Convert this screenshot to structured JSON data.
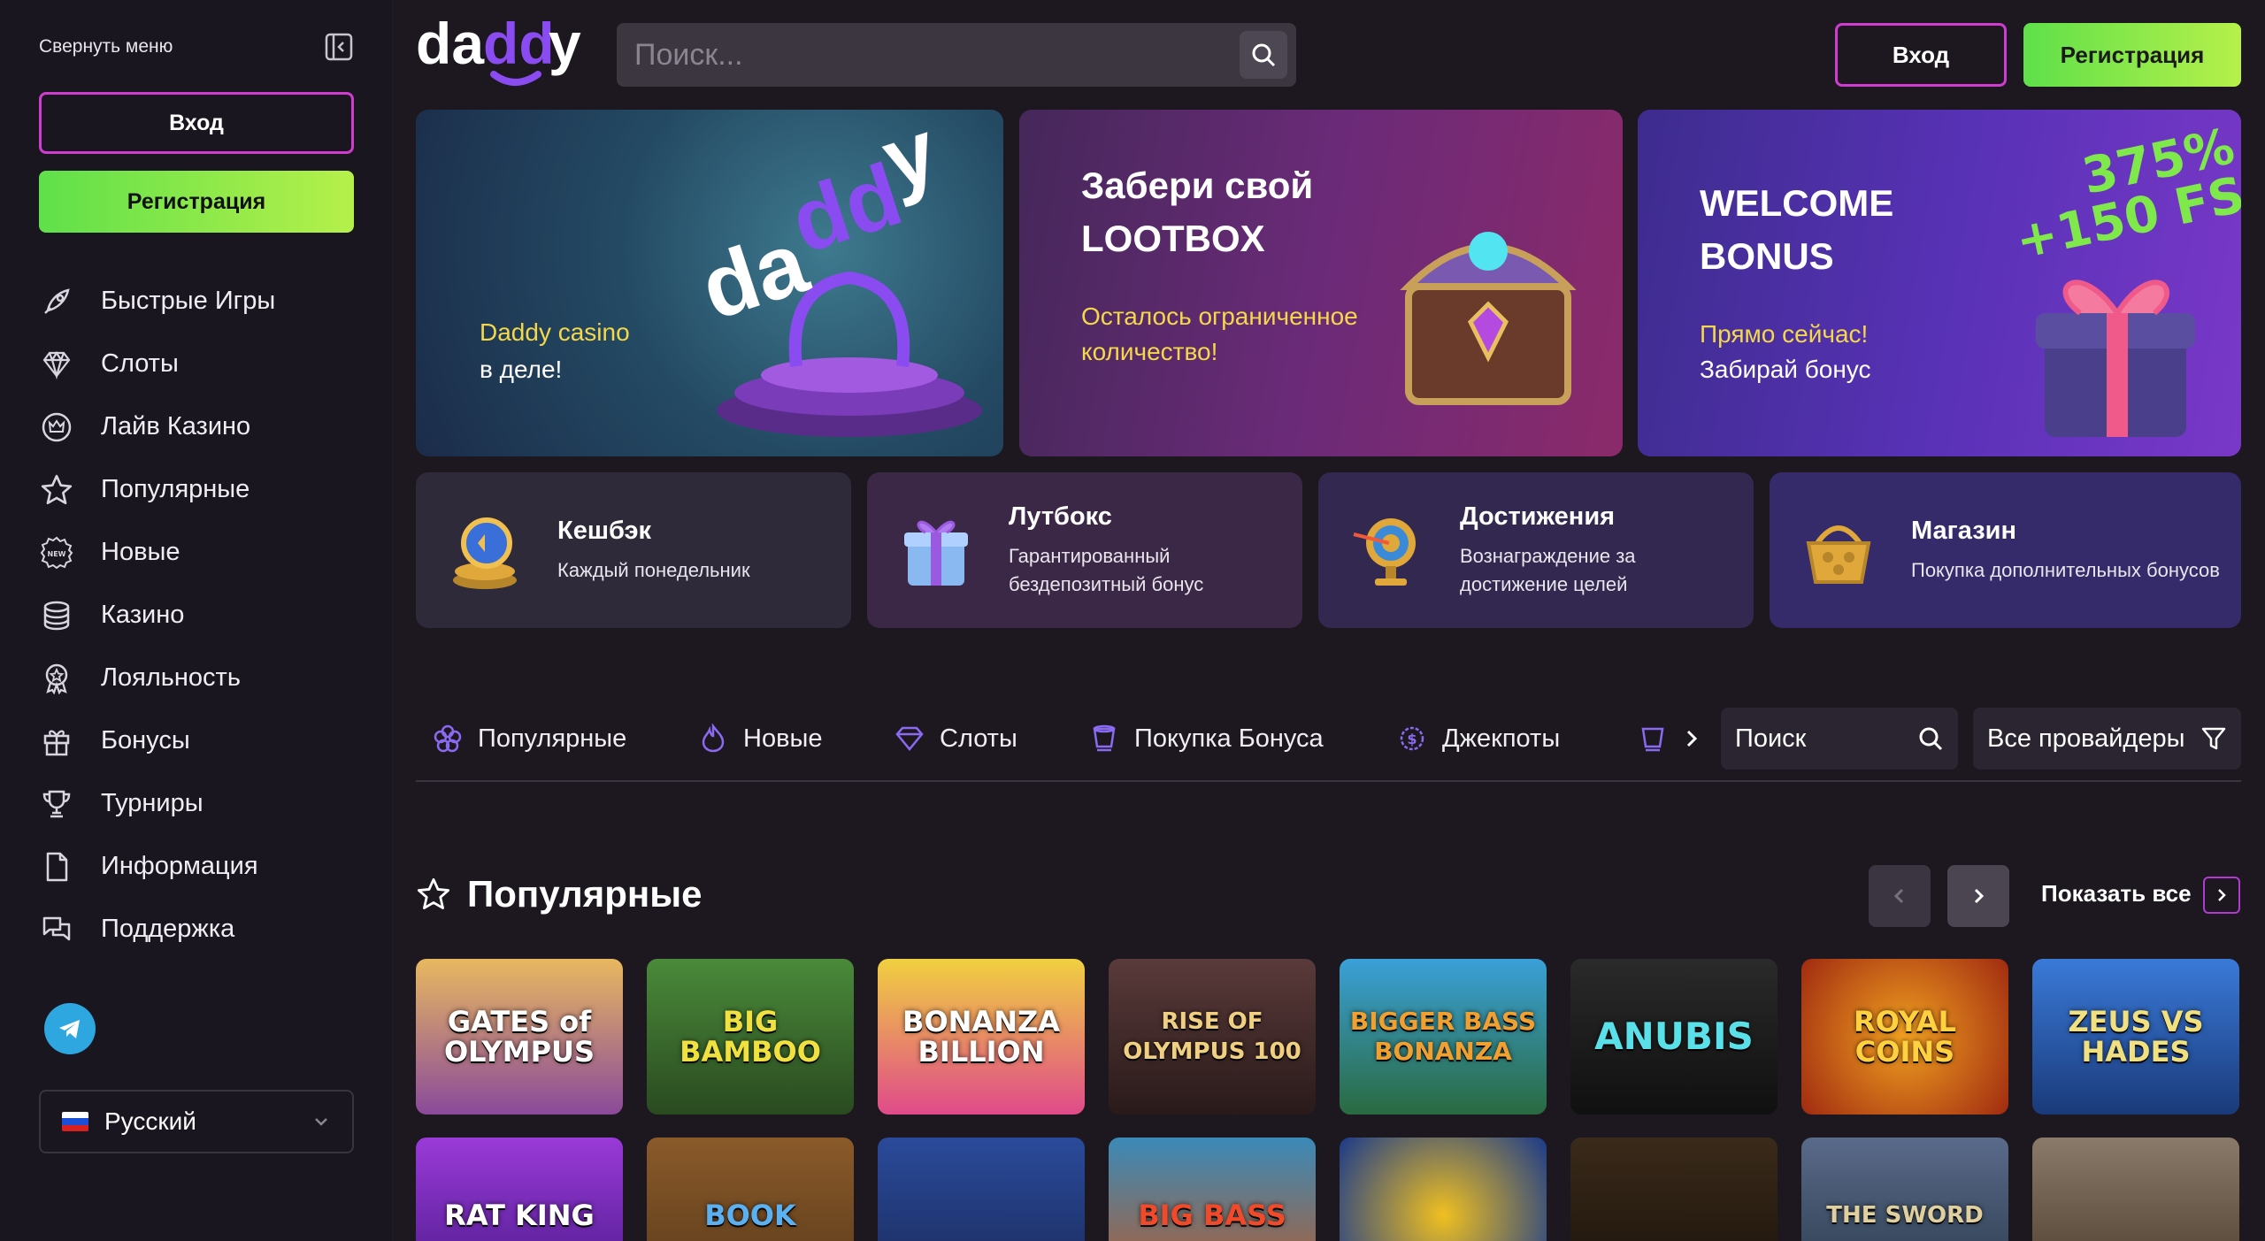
{
  "sidebar": {
    "collapse_label": "Свернуть меню",
    "login_label": "Вход",
    "register_label": "Регистрация",
    "items": [
      {
        "label": "Быстрые Игры",
        "icon": "rocket-icon"
      },
      {
        "label": "Слоты",
        "icon": "diamond-icon"
      },
      {
        "label": "Лайв Казино",
        "icon": "crown-circle-icon"
      },
      {
        "label": "Популярные",
        "icon": "star-icon"
      },
      {
        "label": "Новые",
        "icon": "new-badge-icon"
      },
      {
        "label": "Казино",
        "icon": "coins-stack-icon"
      },
      {
        "label": "Лояльность",
        "icon": "medal-icon"
      },
      {
        "label": "Бонусы",
        "icon": "gift-icon"
      },
      {
        "label": "Турниры",
        "icon": "trophy-icon"
      },
      {
        "label": "Информация",
        "icon": "document-icon"
      },
      {
        "label": "Поддержка",
        "icon": "chat-icon"
      }
    ],
    "language": "Русский"
  },
  "header": {
    "logo_text": "daddy",
    "search_placeholder": "Поиск...",
    "login_label": "Вход",
    "register_label": "Регистрация"
  },
  "banners": [
    {
      "logo_text": "daddy",
      "line1": "Daddy casino",
      "line2": "в деле!"
    },
    {
      "title1": "Забери свой",
      "title2": "LOOTBOX",
      "line1": "Осталось ограниченное",
      "line2": "количество!"
    },
    {
      "title1": "WELCOME",
      "title2": "BONUS",
      "badge1": "375%",
      "badge2": "+150 FS",
      "line1": "Прямо сейчас!",
      "line2": "Забирай бонус"
    }
  ],
  "promos": [
    {
      "title": "Кешбэк",
      "line1": "Каждый понедельник",
      "line2": ""
    },
    {
      "title": "Лутбокс",
      "line1": "Гарантированный",
      "line2": "бездепозитный бонус"
    },
    {
      "title": "Достижения",
      "line1": "Вознаграждение за",
      "line2": "достижение целей"
    },
    {
      "title": "Магазин",
      "line1": "Покупка дополнительных бонусов",
      "line2": ""
    }
  ],
  "categories": {
    "tabs": [
      "Популярные",
      "Новые",
      "Слоты",
      "Покупка Бонуса",
      "Джекпоты"
    ],
    "search_placeholder": "Поиск",
    "providers_label": "Все провайдеры"
  },
  "popular": {
    "title": "Популярные",
    "show_all": "Показать все",
    "games_row1": [
      "GATES of OLYMPUS",
      "BIG BAMBOO",
      "BONANZA BILLION",
      "RISE OF OLYMPUS 100",
      "BIGGER BASS BONANZA",
      "ANUBIS",
      "ROYAL COINS",
      "ZEUS VS HADES"
    ],
    "games_row2": [
      "RAT KING",
      "BOOK",
      "",
      "BIG BASS",
      "",
      "",
      "THE SWORD",
      ""
    ]
  },
  "colors": {
    "accent_magenta": "#d03bd0",
    "accent_green": "#5fe04a",
    "accent_purple": "#8a4bf0",
    "highlight_yellow": "#f4d84a"
  }
}
